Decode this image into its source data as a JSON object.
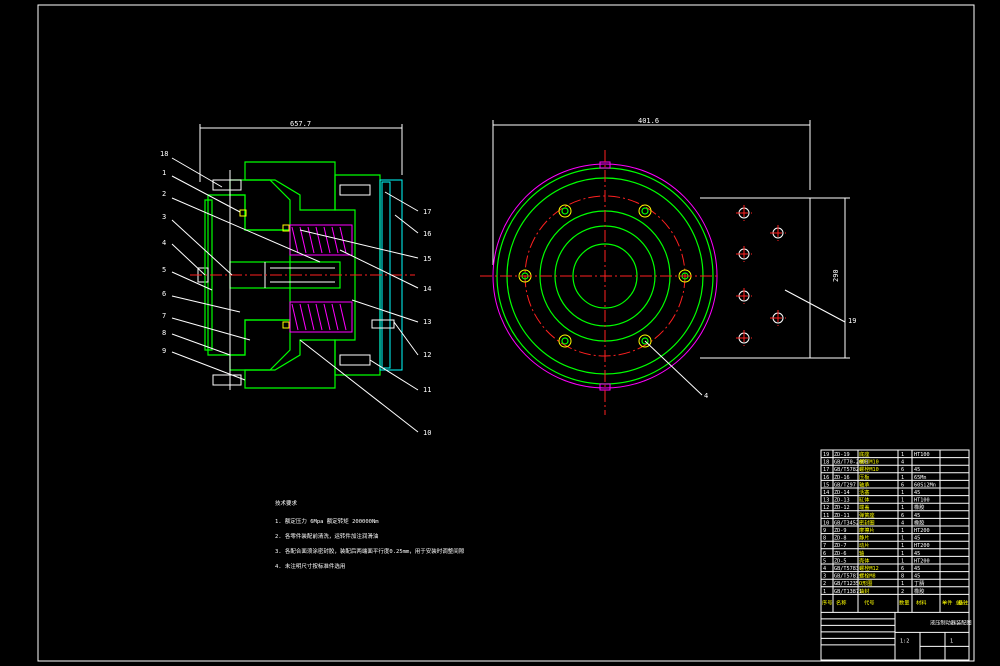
{
  "drawing": {
    "dimensions": {
      "left_width": "657.7",
      "right_width": "401.6",
      "right_height": "290"
    },
    "balloons_left": [
      "18",
      "1",
      "2",
      "3",
      "4",
      "5",
      "6",
      "7",
      "8",
      "9"
    ],
    "balloons_right": [
      "17",
      "16",
      "15",
      "14",
      "13",
      "12",
      "11",
      "10"
    ],
    "balloons_plan": [
      "19",
      "4"
    ],
    "notes": {
      "title": "技术要求",
      "lines": [
        "1. 额定压力 6Mpa 额定转矩 200000Nm",
        "2. 各零件装配前清洗，运转件加注润滑油",
        "3. 各配合面须涂密封胶，装配后两端面平行度0.25mm，用于安装时调整间隙",
        "4. 未注明尺寸按标准件选用"
      ]
    }
  },
  "bom": {
    "rows": [
      {
        "no": "19",
        "code": "ZD-19",
        "name": "底座",
        "qty": "1",
        "mat": "HT100"
      },
      {
        "no": "18",
        "code": "GB/T70-2000",
        "name": "螺钉M10",
        "qty": "4",
        "mat": ""
      },
      {
        "no": "17",
        "code": "GB/T5782",
        "name": "螺栓M10",
        "qty": "6",
        "mat": "45"
      },
      {
        "no": "16",
        "code": "ZD-16",
        "name": "压板",
        "qty": "1",
        "mat": "65Mn"
      },
      {
        "no": "15",
        "code": "GB/T297",
        "name": "轴承",
        "qty": "6",
        "mat": "60Si2Mn"
      },
      {
        "no": "14",
        "code": "ZD-14",
        "name": "活塞",
        "qty": "1",
        "mat": "45"
      },
      {
        "no": "13",
        "code": "ZD-13",
        "name": "缸体",
        "qty": "1",
        "mat": "HT100"
      },
      {
        "no": "12",
        "code": "ZD-12",
        "name": "端盖",
        "qty": "1",
        "mat": "橡胶"
      },
      {
        "no": "11",
        "code": "ZD-11",
        "name": "弹簧座",
        "qty": "6",
        "mat": "45"
      },
      {
        "no": "10",
        "code": "GB/T3452",
        "name": "密封圈",
        "qty": "4",
        "mat": "橡胶"
      },
      {
        "no": "9",
        "code": "ZD-9",
        "name": "摩擦片",
        "qty": "1",
        "mat": "HT200"
      },
      {
        "no": "8",
        "code": "ZD-8",
        "name": "静片",
        "qty": "1",
        "mat": "45"
      },
      {
        "no": "7",
        "code": "ZD-7",
        "name": "动片",
        "qty": "1",
        "mat": "HT200"
      },
      {
        "no": "6",
        "code": "ZD-6",
        "name": "轴",
        "qty": "1",
        "mat": "45"
      },
      {
        "no": "5",
        "code": "ZD-5",
        "name": "壳体",
        "qty": "1",
        "mat": "HT200"
      },
      {
        "no": "4",
        "code": "GB/T5783",
        "name": "螺栓M12",
        "qty": "6",
        "mat": "45"
      },
      {
        "no": "3",
        "code": "GB/T5781",
        "name": "螺栓M8",
        "qty": "8",
        "mat": "45"
      },
      {
        "no": "2",
        "code": "GB/T1235",
        "name": "O形圈",
        "qty": "1",
        "mat": "丁腈"
      },
      {
        "no": "1",
        "code": "GB/T13871",
        "name": "油封",
        "qty": "2",
        "mat": "橡胶"
      }
    ],
    "header": {
      "no": "序号",
      "name": "名称",
      "code": "代号",
      "qty": "数量",
      "mat": "材料",
      "weight": "单件 总计",
      "note": "备注"
    },
    "title": "液压制动器装配图",
    "scale": "1:2",
    "sheet": "1"
  }
}
